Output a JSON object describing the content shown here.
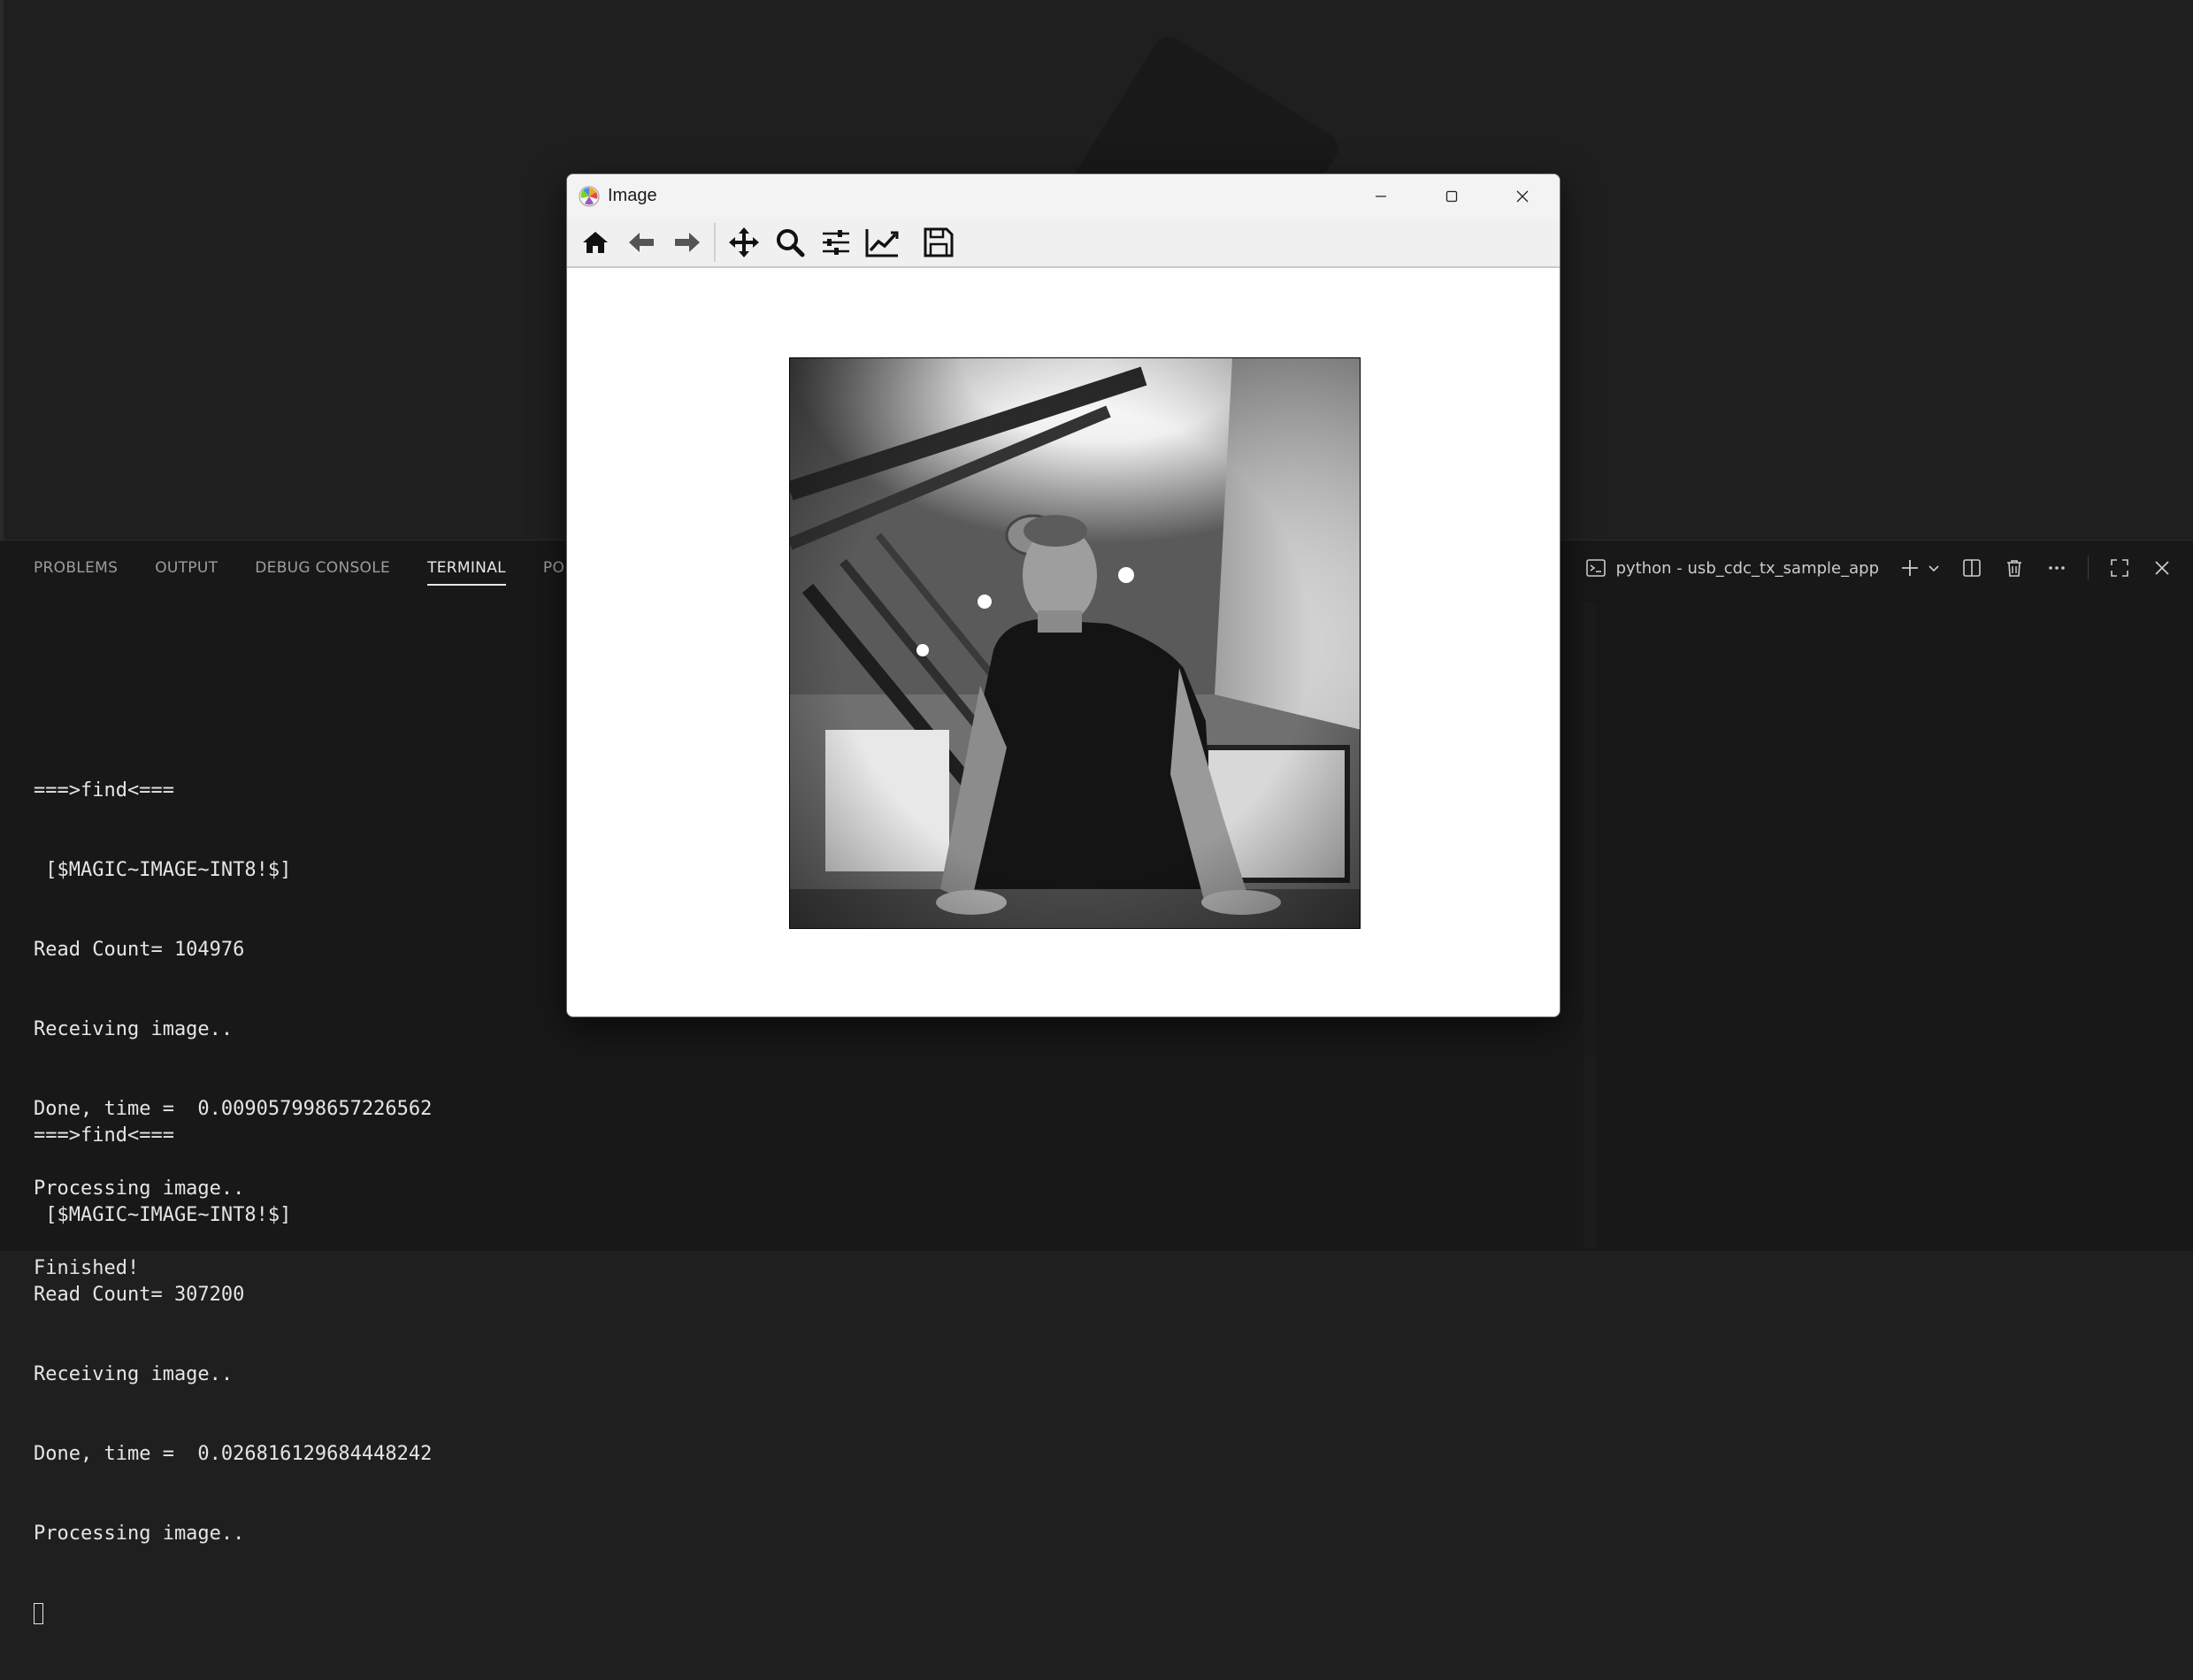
{
  "window": {
    "title": "Image"
  },
  "toolbar": {
    "buttons": [
      "home-icon",
      "back-arrow-icon",
      "forward-arrow-icon",
      "pan-icon",
      "zoom-icon",
      "configure-subplots-icon",
      "edit-axes-icon",
      "save-icon"
    ]
  },
  "panel": {
    "tabs": [
      {
        "label": "PROBLEMS"
      },
      {
        "label": "OUTPUT"
      },
      {
        "label": "DEBUG CONSOLE"
      },
      {
        "label": "TERMINAL"
      },
      {
        "label": "PO"
      }
    ],
    "active_tab": "TERMINAL",
    "terminal_name": "python - usb_cdc_tx_sample_app"
  },
  "terminal": {
    "block1": [
      "===>find<===",
      " [$MAGIC~IMAGE~INT8!$]",
      "Read Count= 104976",
      "Receiving image..",
      "Done, time =  0.009057998657226562",
      "Processing image..",
      "Finished!"
    ],
    "block2": [
      "===>find<===",
      " [$MAGIC~IMAGE~INT8!$]",
      "Read Count= 307200",
      "Receiving image..",
      "Done, time =  0.026816129684448242",
      "Processing image.."
    ]
  },
  "colors": {
    "background": "#1f1f1f",
    "panel": "#181818",
    "terminal_text": "#e5e5e5",
    "window_bg": "#ffffff"
  }
}
